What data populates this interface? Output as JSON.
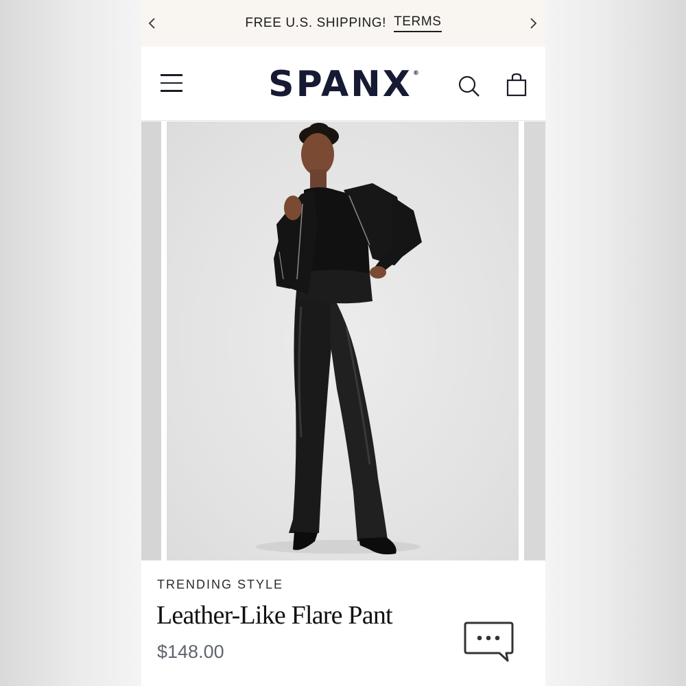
{
  "promo_bar": {
    "message": "FREE U.S. SHIPPING!",
    "link_label": "TERMS",
    "prev_icon": "chevron-left-icon",
    "next_icon": "chevron-right-icon"
  },
  "header": {
    "brand": "SPANX",
    "brand_mark": "®",
    "menu_icon": "hamburger-menu-icon",
    "search_icon": "search-icon",
    "bag_icon": "shopping-bag-icon"
  },
  "product": {
    "eyebrow": "TRENDING STYLE",
    "name": "Leather-Like Flare Pant",
    "price": "$148.00",
    "image_alt": "Model wearing black leather-like flare pants with a black leather jacket"
  },
  "chat": {
    "icon": "chat-bubble-icon"
  },
  "colors": {
    "promo_background": "#f9f5f1",
    "brand_navy": "#161a33",
    "price_gray": "#5f6470",
    "photo_background": "#e4e4e4"
  }
}
